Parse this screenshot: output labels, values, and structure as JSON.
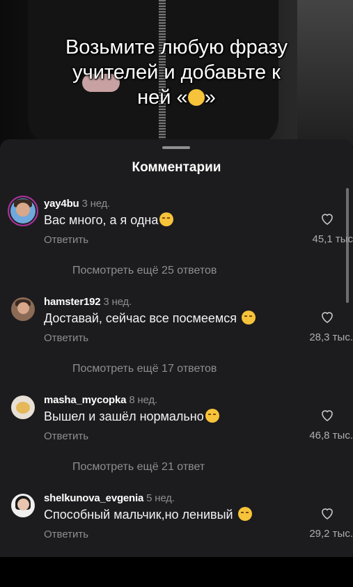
{
  "video": {
    "caption": "Возьмите любую фразу учителей и добавьте к ней «😏»",
    "caption_line1": "Возьмите любую фразу",
    "caption_line2": "учителей и добавьте к",
    "caption_line3_pre": "ней «",
    "caption_line3_post": "»"
  },
  "sheet": {
    "title": "Комментарии"
  },
  "comments": [
    {
      "username": "yay4bu",
      "time": "3 нед.",
      "text": "Вас много, а я одна",
      "reply": "Ответить",
      "likes": "45,1 тыс",
      "more": "Посмотреть ещё 25 ответов"
    },
    {
      "username": "hamster192",
      "time": "3 нед.",
      "text": "Доставай, сейчас все посмеемся ",
      "reply": "Ответить",
      "likes": "28,3 тыс.",
      "more": "Посмотреть ещё 17 ответов"
    },
    {
      "username": "masha_mycopka",
      "time": "8 нед.",
      "text": "Вышел и зашёл нормально",
      "reply": "Ответить",
      "likes": "46,8 тыс.",
      "more": "Посмотреть ещё 21 ответ"
    },
    {
      "username": "shelkunova_evgenia",
      "time": "5 нед.",
      "text": "Способный мальчик,но ленивый ",
      "reply": "Ответить",
      "likes": "29,2 тыс."
    }
  ],
  "icons": {
    "emoji": "smirking-face-icon",
    "like": "heart-outline-icon"
  },
  "colors": {
    "sheet_bg": "#1c1c1e",
    "secondary_text": "#8e8e93",
    "story_ring": "#b22ea0"
  }
}
